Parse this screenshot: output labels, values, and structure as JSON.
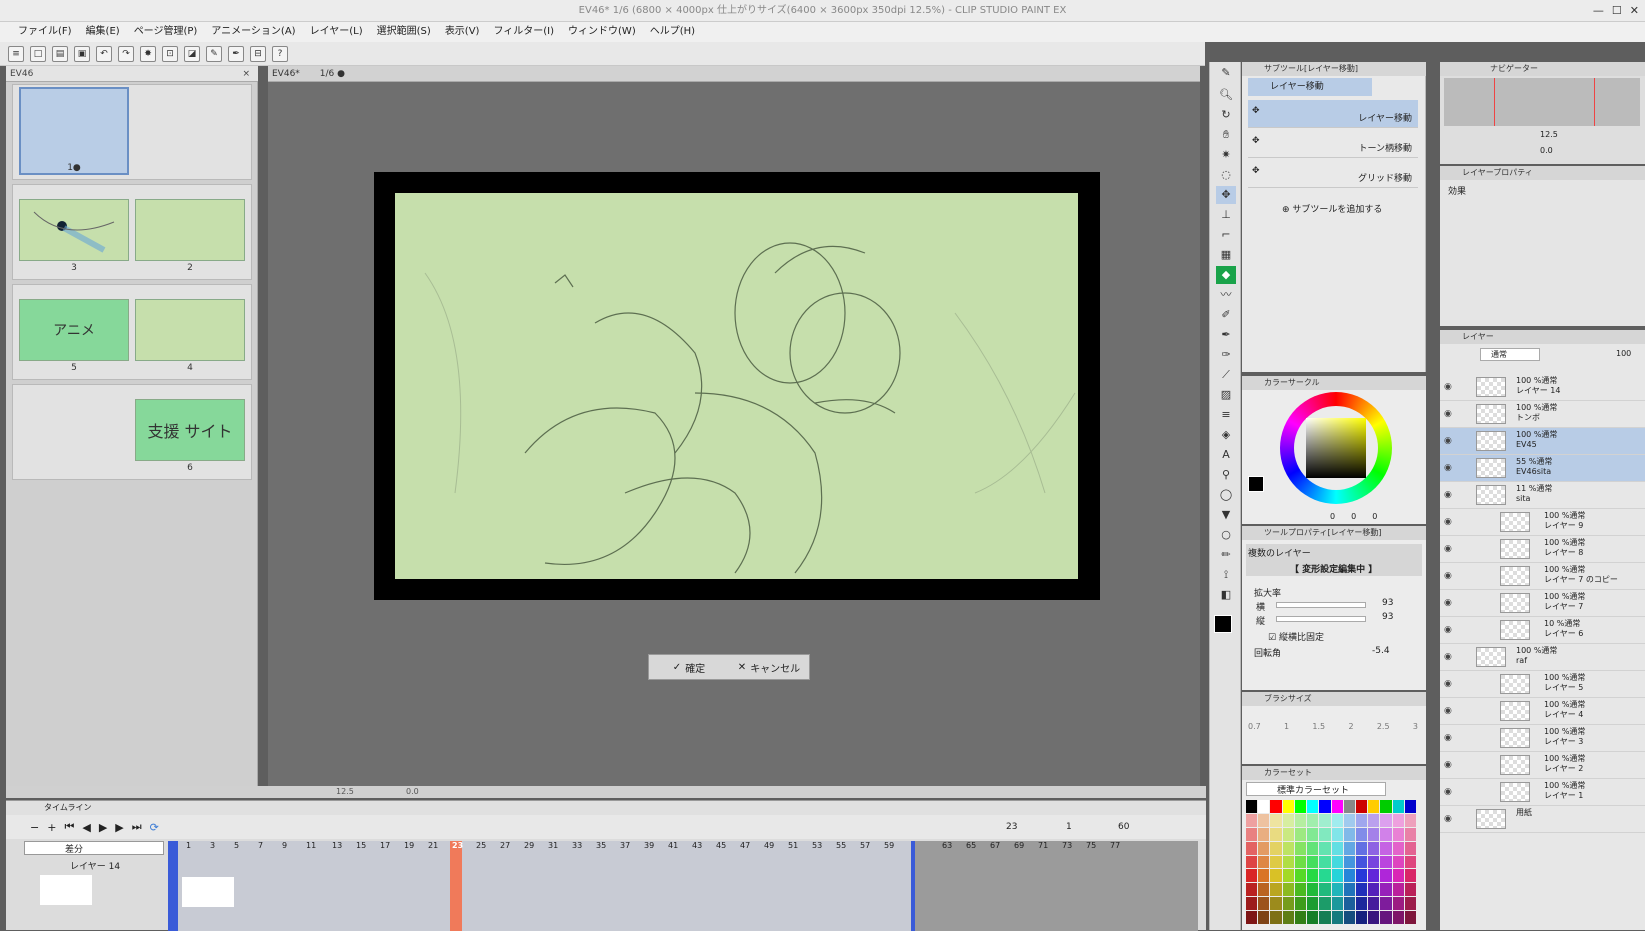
{
  "window": {
    "title": "EV46* 1/6 (6800 × 4000px 仕上がりサイズ(6400 × 3600px 350dpi 12.5%) - CLIP STUDIO PAINT EX"
  },
  "menu": [
    "ファイル(F)",
    "編集(E)",
    "ページ管理(P)",
    "アニメーション(A)",
    "レイヤー(L)",
    "選択範囲(S)",
    "表示(V)",
    "フィルター(I)",
    "ウィンドウ(W)",
    "ヘルプ(H)"
  ],
  "pages_tab": {
    "label": "EV46"
  },
  "pages": [
    {
      "num": "1●",
      "label": ""
    },
    {
      "num": "3",
      "label": ""
    },
    {
      "num": "2",
      "label": ""
    },
    {
      "num": "5",
      "label": "アニメ"
    },
    {
      "num": "4",
      "label": ""
    },
    {
      "num": "6",
      "label": "支援 サイト"
    }
  ],
  "canvas_tab": {
    "label": "EV46*",
    "page": "1/6 ●"
  },
  "confirm": {
    "ok": "確定",
    "cancel": "キャンセル"
  },
  "canvas_status": {
    "zoom": "12.5",
    "angle": "0.0"
  },
  "timeline": {
    "title": "タイムライン",
    "track_select": "差分",
    "layer": "レイヤー 14",
    "current": "23",
    "start": "1",
    "end": "60",
    "frames": [
      "1",
      "3",
      "5",
      "7",
      "9",
      "11",
      "13",
      "15",
      "17",
      "19",
      "21",
      "23",
      "25",
      "27",
      "29",
      "31",
      "33",
      "35",
      "37",
      "39",
      "41",
      "43",
      "45",
      "47",
      "49",
      "51",
      "53",
      "55",
      "57",
      "59",
      "63",
      "65",
      "67",
      "69",
      "71",
      "73",
      "75",
      "77"
    ]
  },
  "subtool": {
    "header": "サブツール[レイヤー移動]",
    "group": "レイヤー移動",
    "items": [
      "レイヤー移動",
      "トーン柄移動",
      "グリッド移動"
    ],
    "add": "サブツールを追加する"
  },
  "colorwheel": {
    "header": "カラーサークル",
    "values": [
      "0",
      "0",
      "0"
    ]
  },
  "toolprop": {
    "header": "ツールプロパティ[レイヤー移動]",
    "target": "複数のレイヤー",
    "banner": "【 変形設定編集中 】",
    "scale": "拡大率",
    "w_label": "横",
    "w": "93",
    "h_label": "縦",
    "h": "93",
    "lock": "縦横比固定",
    "rot": "回転角",
    "rot_val": "-5.4"
  },
  "brushsize": {
    "header": "ブラシサイズ",
    "sizes": [
      "0.7",
      "1",
      "1.5",
      "2",
      "2.5",
      "3"
    ]
  },
  "colorset": {
    "header": "カラーセット",
    "set": "標準カラーセット"
  },
  "navigator": {
    "header": "ナビゲーター",
    "zoom": "12.5",
    "angle": "0.0"
  },
  "layerprop": {
    "header": "レイヤープロパティ",
    "effect": "効果"
  },
  "layers": {
    "header": "レイヤー",
    "blend": "通常",
    "opacity": "100",
    "rows": [
      {
        "mode": "100 %通常",
        "name": "レイヤー 14",
        "sel": false
      },
      {
        "mode": "100 %通常",
        "name": "トンボ",
        "sel": false
      },
      {
        "mode": "100 %通常",
        "name": "EV45",
        "sel": true
      },
      {
        "mode": "55 %通常",
        "name": "EV46sita",
        "sel": true
      },
      {
        "mode": "11 %通常",
        "name": "sita",
        "sel": false
      },
      {
        "mode": "100 %通常",
        "name": "レイヤー 9",
        "sel": false
      },
      {
        "mode": "100 %通常",
        "name": "レイヤー 8",
        "sel": false
      },
      {
        "mode": "100 %通常",
        "name": "レイヤー 7 のコピー",
        "sel": false
      },
      {
        "mode": "100 %通常",
        "name": "レイヤー 7",
        "sel": false
      },
      {
        "mode": "10 %通常",
        "name": "レイヤー 6",
        "sel": false
      },
      {
        "mode": "100 %通常",
        "name": "raf",
        "sel": false
      },
      {
        "mode": "100 %通常",
        "name": "レイヤー 5",
        "sel": false
      },
      {
        "mode": "100 %通常",
        "name": "レイヤー 4",
        "sel": false
      },
      {
        "mode": "100 %通常",
        "name": "レイヤー 3",
        "sel": false
      },
      {
        "mode": "100 %通常",
        "name": "レイヤー 2",
        "sel": false
      },
      {
        "mode": "100 %通常",
        "name": "レイヤー 1",
        "sel": false
      },
      {
        "mode": "",
        "name": "用紙",
        "sel": false
      }
    ]
  },
  "colors": {
    "accent": "#b8cce6",
    "paper": "#c6dfac",
    "thumbGreen": "#86d89a",
    "playhead": "#f07a5a",
    "timelineMarker": "#3a5bd8"
  }
}
